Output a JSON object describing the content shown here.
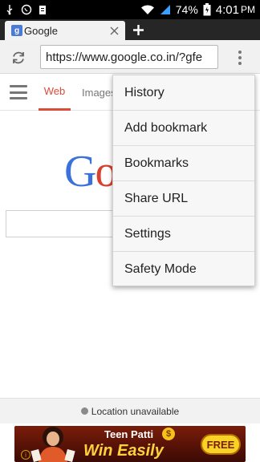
{
  "status_bar": {
    "battery": "74%",
    "time": "4:01",
    "period": "PM",
    "icons": [
      "usb-icon",
      "whatsapp-icon",
      "notification-icon",
      "wifi-icon",
      "signal-icon",
      "battery-charging-icon"
    ]
  },
  "tab": {
    "favicon": "g",
    "title": "Google"
  },
  "toolbar": {
    "url": "https://www.google.co.in/?gfe"
  },
  "google": {
    "tabs": [
      "Web",
      "Images"
    ],
    "logo_visible": "Goo"
  },
  "menu": {
    "items": [
      "History",
      "Add bookmark",
      "Bookmarks",
      "Share URL",
      "Settings",
      "Safety Mode"
    ]
  },
  "footer": {
    "location": "Location unavailable"
  },
  "ad": {
    "title": "Teen Patti",
    "tagline": "Win Easily",
    "badge": "FREE",
    "coin": "$",
    "info": "i"
  },
  "colors": {
    "accent_red": "#dd4b39",
    "tab_bar": "#262626",
    "status_bar": "#000000"
  }
}
